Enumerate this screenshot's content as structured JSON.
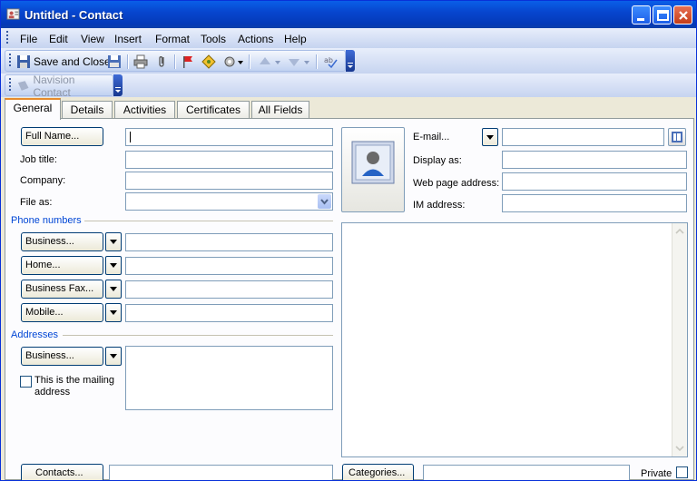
{
  "window": {
    "title": "Untitled - Contact"
  },
  "menu": {
    "items": [
      {
        "label": "File"
      },
      {
        "label": "Edit"
      },
      {
        "label": "View"
      },
      {
        "label": "Insert"
      },
      {
        "label": "Format"
      },
      {
        "label": "Tools"
      },
      {
        "label": "Actions"
      },
      {
        "label": "Help"
      }
    ]
  },
  "toolbar": {
    "save_close_label": "Save and Close"
  },
  "toolbar2": {
    "navision_label": "Navision Contact"
  },
  "tabs": [
    {
      "label": "General"
    },
    {
      "label": "Details"
    },
    {
      "label": "Activities"
    },
    {
      "label": "Certificates"
    },
    {
      "label": "All Fields"
    }
  ],
  "general": {
    "full_name_button": "Full Name...",
    "job_title_label": "Job title:",
    "company_label": "Company:",
    "file_as_label": "File as:",
    "phone_section": "Phone numbers",
    "phones": [
      {
        "label": "Business..."
      },
      {
        "label": "Home..."
      },
      {
        "label": "Business Fax..."
      },
      {
        "label": "Mobile..."
      }
    ],
    "addresses_section": "Addresses",
    "address_button": "Business...",
    "mailing_checkbox_label": "This is the mailing address",
    "email_label": "E-mail...",
    "display_as_label": "Display as:",
    "web_label": "Web page address:",
    "im_label": "IM address:",
    "contacts_button": "Contacts...",
    "categories_button": "Categories...",
    "private_label": "Private"
  }
}
